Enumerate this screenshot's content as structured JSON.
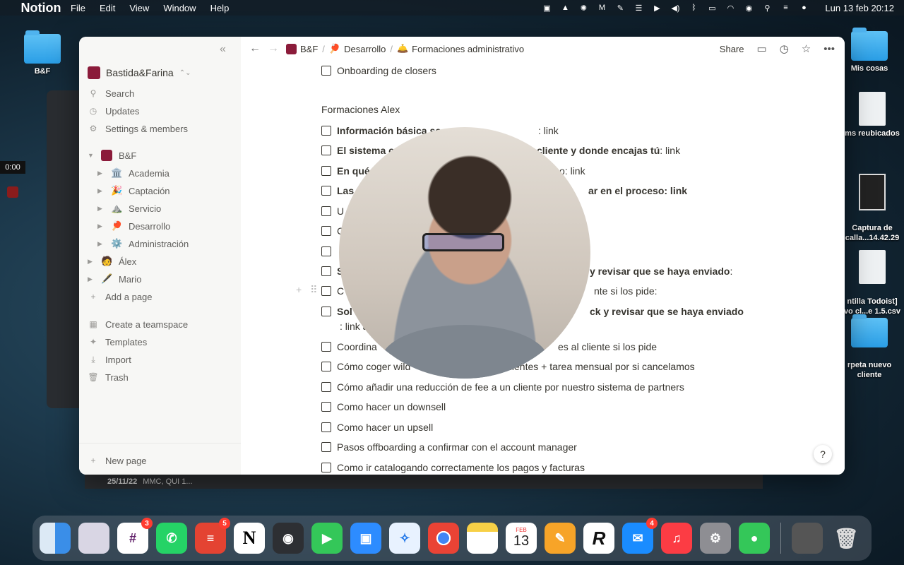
{
  "menubar": {
    "app": "Notion",
    "items": [
      "File",
      "Edit",
      "View",
      "Window",
      "Help"
    ],
    "clock": "Lun 13 feb 20:12"
  },
  "desktop": {
    "left_folder": "B&F",
    "right_icons": [
      "Mis cosas",
      "ms reubicados",
      "Captura de\ncalla...14.42.29",
      "ntilla Todoist]\nvo cl...e 1.5.csv",
      "rpeta nuevo\ncliente"
    ]
  },
  "timer": "0:00",
  "background_strip": {
    "date": "25/11/22",
    "text": "MMC, QUI 1..."
  },
  "sidebar": {
    "workspace": "Bastida&Farina",
    "top_items": [
      {
        "label": "Search",
        "icon": "search-icon"
      },
      {
        "label": "Updates",
        "icon": "clock-icon"
      },
      {
        "label": "Settings & members",
        "icon": "gear-icon"
      }
    ],
    "teamspace": "B&F",
    "pages": [
      {
        "label": "Academia",
        "emoji": "🏛️"
      },
      {
        "label": "Captación",
        "emoji": "🎉"
      },
      {
        "label": "Servicio",
        "emoji": "⛰️"
      },
      {
        "label": "Desarrollo",
        "emoji": "🏓"
      },
      {
        "label": "Administración",
        "emoji": "⚙️"
      }
    ],
    "people": [
      {
        "label": "Álex",
        "emoji": "🧑"
      },
      {
        "label": "Mario",
        "emoji": "🖋️"
      }
    ],
    "add_page": "Add a page",
    "bottom_items": [
      {
        "label": "Create a teamspace",
        "icon": "teamspace-icon"
      },
      {
        "label": "Templates",
        "icon": "templates-icon"
      },
      {
        "label": "Import",
        "icon": "import-icon"
      },
      {
        "label": "Trash",
        "icon": "trash-icon"
      }
    ],
    "new_page": "New page"
  },
  "breadcrumb": [
    {
      "label": "B&F",
      "emoji": "■"
    },
    {
      "label": "Desarrollo",
      "emoji": "🏓"
    },
    {
      "label": "Formaciones administrativo",
      "emoji": "🛎️"
    }
  ],
  "topbar": {
    "share": "Share"
  },
  "content": {
    "first_item": "Onboarding de closers",
    "section_heading": "Formaciones Alex",
    "items": [
      {
        "bold": "Información básica so",
        "text": ""
      },
      {
        "bold": "El sistema c",
        "bold2": "cliente y donde encajas tú",
        "text": ": link"
      },
      {
        "bold": "En qué",
        "text": ""
      },
      {
        "bold": "Las",
        "text": ""
      },
      {
        "bold": "",
        "text": "U"
      },
      {
        "bold": "",
        "text": "C"
      },
      {
        "bold": "",
        "text": ""
      },
      {
        "bold": "S",
        "bold2": "y revisar que se haya enviado",
        "text": ":"
      },
      {
        "bold": "",
        "text": "C"
      },
      {
        "bold": "Sol",
        "bold2": "ck y revisar que se haya enviado",
        "text": ": link aquí"
      },
      {
        "bold": "",
        "text": "Coordina"
      },
      {
        "bold": "",
        "text": "Cómo coger wild"
      },
      {
        "bold": "",
        "text": "Cómo añadir una reducción de fee a un cliente por nuestro sistema de partners"
      },
      {
        "bold": "",
        "text": "Como hacer un downsell"
      },
      {
        "bold": "",
        "text": "Como hacer un upsell"
      },
      {
        "bold": "",
        "text": "Pasos offboarding a confirmar con el account manager"
      },
      {
        "bold": "",
        "text": "Como ir catalogando correctamente los pagos y facturas"
      }
    ],
    "tails": {
      "r1": ": link",
      "r3": "o: link",
      "r4": "ar en el proceso: link",
      "r9": "nte si los pide:",
      "r11": "es al cliente si los pide",
      "r12": "los clientes + tarea mensual por si cancelamos"
    }
  },
  "dock": {
    "badges": {
      "slack": "3",
      "todoist": "5",
      "mail": "4"
    },
    "calendar_month": "FEB",
    "calendar_day": "13"
  }
}
